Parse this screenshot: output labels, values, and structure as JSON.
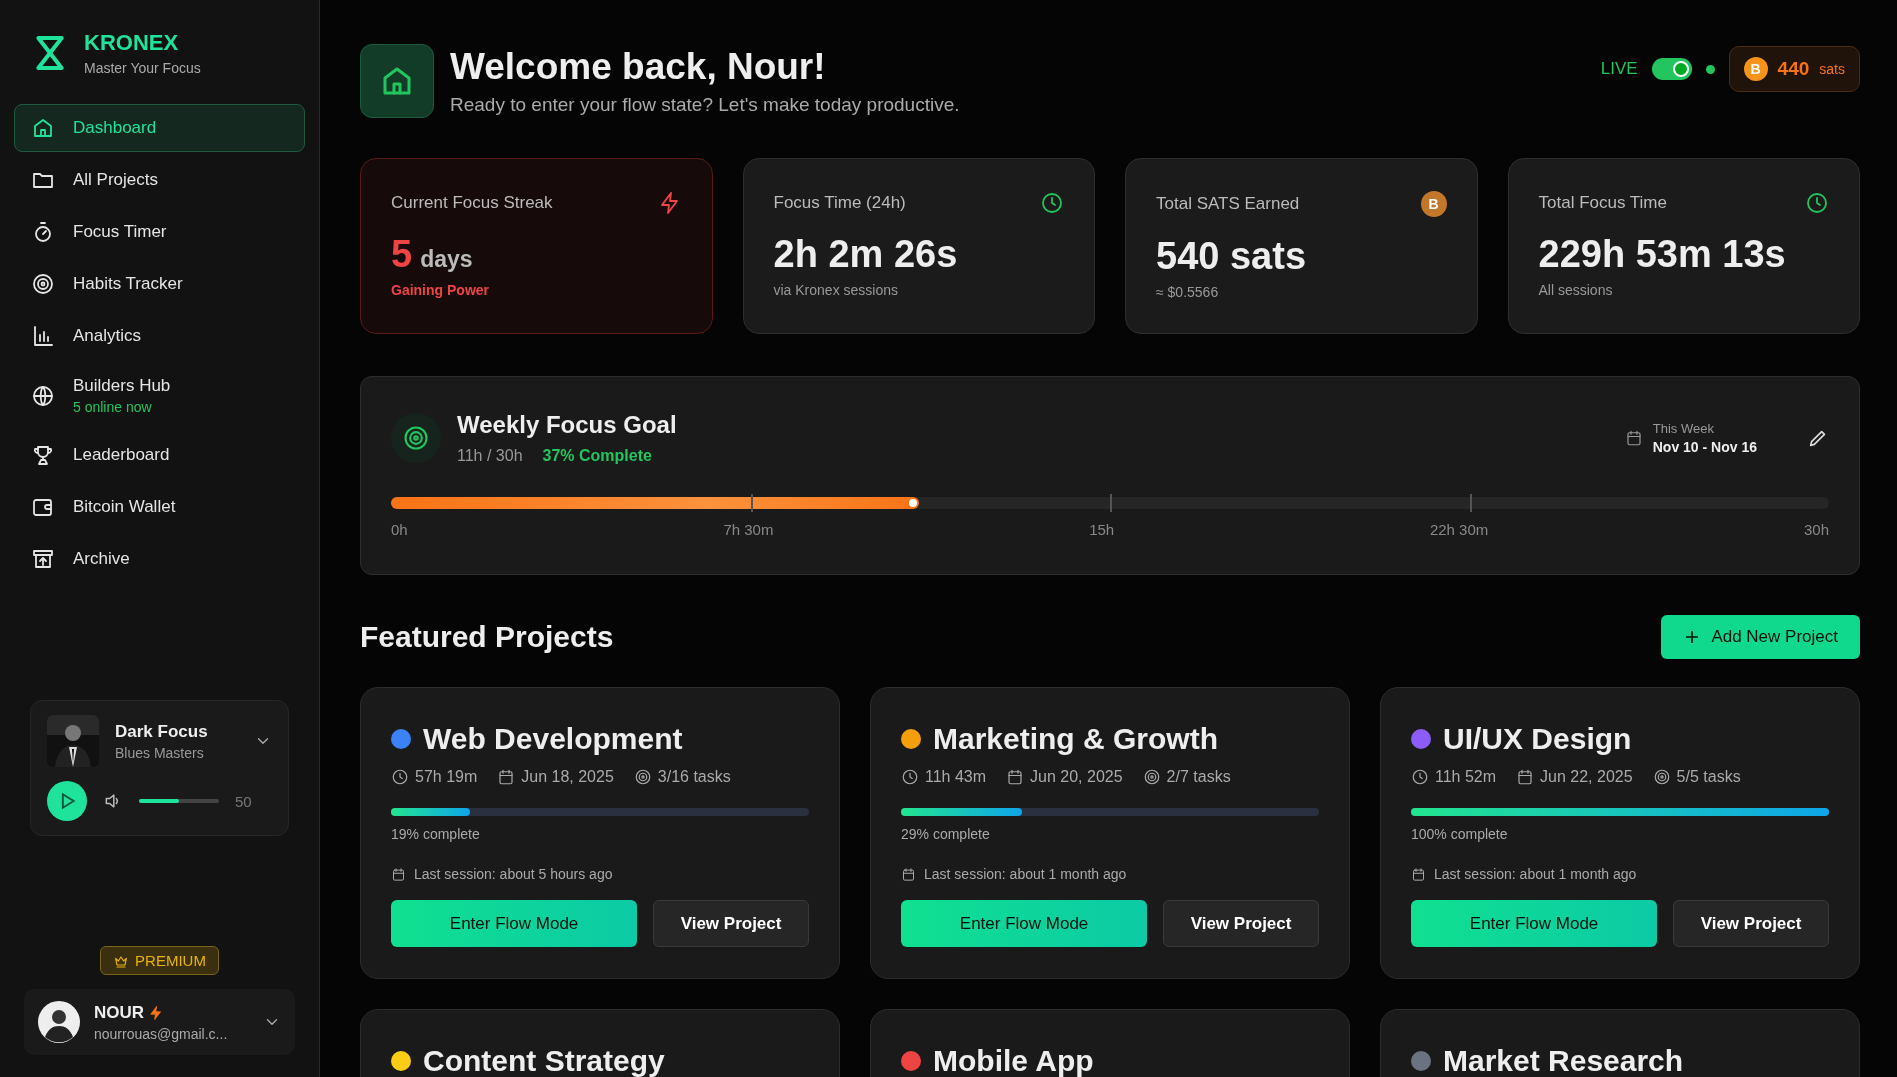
{
  "sidebar": {
    "brand": "KRONEX",
    "tagline": "Master Your Focus",
    "items": [
      {
        "label": "Dashboard",
        "selected": true
      },
      {
        "label": "All Projects",
        "selected": false
      },
      {
        "label": "Focus Timer",
        "selected": false
      },
      {
        "label": "Habits Tracker",
        "selected": false
      },
      {
        "label": "Analytics",
        "selected": false
      },
      {
        "label": "Builders Hub",
        "subtitle": "5 online now",
        "selected": false
      },
      {
        "label": "Leaderboard",
        "selected": false
      },
      {
        "label": "Bitcoin Wallet",
        "selected": false
      },
      {
        "label": "Archive",
        "selected": false
      }
    ],
    "player": {
      "title": "Dark Focus",
      "artist": "Blues Masters",
      "level": 0.5,
      "volume": "50"
    },
    "badge": "PREMIUM",
    "user": {
      "name": "NOUR",
      "email": "nourrouas@gmail.c..."
    }
  },
  "header": {
    "title": "Welcome back, Nour!",
    "subtitle": "Ready to enter your flow state? Let's make today productive.",
    "live_label": "LIVE",
    "live_on": true,
    "sats_symbol": "B",
    "sats_value": "440",
    "sats_unit": "sats"
  },
  "stats": [
    {
      "kind": "streak",
      "label": "Current Focus Streak",
      "value": "5",
      "unit": "days",
      "note": "Gaining Power"
    },
    {
      "kind": "stat",
      "label": "Focus Time (24h)",
      "value": "2h 2m 26s",
      "note": "via Kronex sessions"
    },
    {
      "kind": "stat",
      "label": "Total SATS Earned",
      "symbol": "B",
      "value": "540 sats",
      "note": "≈ $0.5566"
    },
    {
      "kind": "stat",
      "label": "Total Focus Time",
      "value": "229h 53m 13s",
      "note": "All sessions"
    }
  ],
  "weekly_goal": {
    "title": "Weekly Focus Goal",
    "progress": "11h / 30h",
    "percent": "37% Complete",
    "week_label": "This Week",
    "week_range": "Nov 10 - Nov 16",
    "level": 0.367,
    "ticks": [
      "0h",
      "7h 30m",
      "15h",
      "22h 30m",
      "30h"
    ]
  },
  "featured": {
    "title": "Featured Projects",
    "add_button": "Add New Project",
    "projects": [
      {
        "name": "Web Development",
        "color": "#3b82f6",
        "time": "57h 19m",
        "date": "Jun 18, 2025",
        "tasks": "3/16 tasks",
        "level": 0.19,
        "percent": "19% complete",
        "last_session": "Last session: about 5 hours ago",
        "primary": "Enter Flow Mode",
        "secondary": "View Project"
      },
      {
        "name": "Marketing & Growth",
        "color": "#f59e0b",
        "time": "11h 43m",
        "date": "Jun 20, 2025",
        "tasks": "2/7 tasks",
        "level": 0.29,
        "percent": "29% complete",
        "last_session": "Last session: about 1 month ago",
        "primary": "Enter Flow Mode",
        "secondary": "View Project"
      },
      {
        "name": "UI/UX Design",
        "color": "#8b5cf6",
        "time": "11h 52m",
        "date": "Jun 22, 2025",
        "tasks": "5/5 tasks",
        "level": 1.0,
        "percent": "100% complete",
        "last_session": "Last session: about 1 month ago",
        "primary": "Enter Flow Mode",
        "secondary": "View Project"
      },
      {
        "name": "Content Strategy",
        "color": "#facc15"
      },
      {
        "name": "Mobile App",
        "color": "#ef4444"
      },
      {
        "name": "Market Research",
        "color": "#6b7280"
      }
    ]
  }
}
